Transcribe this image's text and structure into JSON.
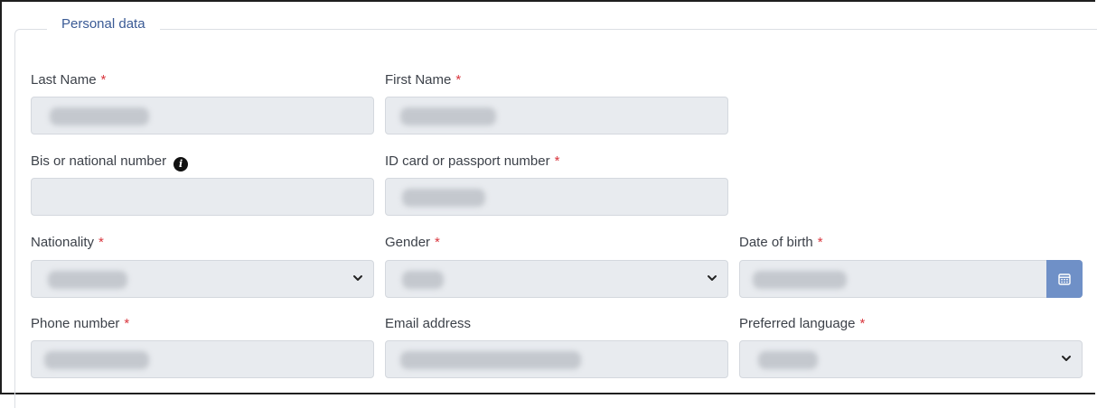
{
  "section": {
    "legend": "Personal data"
  },
  "fields": {
    "last_name": {
      "label": "Last Name"
    },
    "first_name": {
      "label": "First Name"
    },
    "bis_number": {
      "label": "Bis or national number"
    },
    "id_card": {
      "label": "ID card or passport number"
    },
    "nationality": {
      "label": "Nationality"
    },
    "gender": {
      "label": "Gender"
    },
    "date_of_birth": {
      "label": "Date of birth"
    },
    "phone": {
      "label": "Phone number"
    },
    "email": {
      "label": "Email address"
    },
    "language": {
      "label": "Preferred language"
    }
  },
  "required_marker": "*",
  "icons": {
    "info": "info-icon",
    "chevron": "chevron-down-icon",
    "calendar": "calendar-icon"
  },
  "colors": {
    "legend": "#3a5a95",
    "required": "#d9363e",
    "field_bg": "#e8ebef",
    "calendar_button": "#6f90c7"
  }
}
